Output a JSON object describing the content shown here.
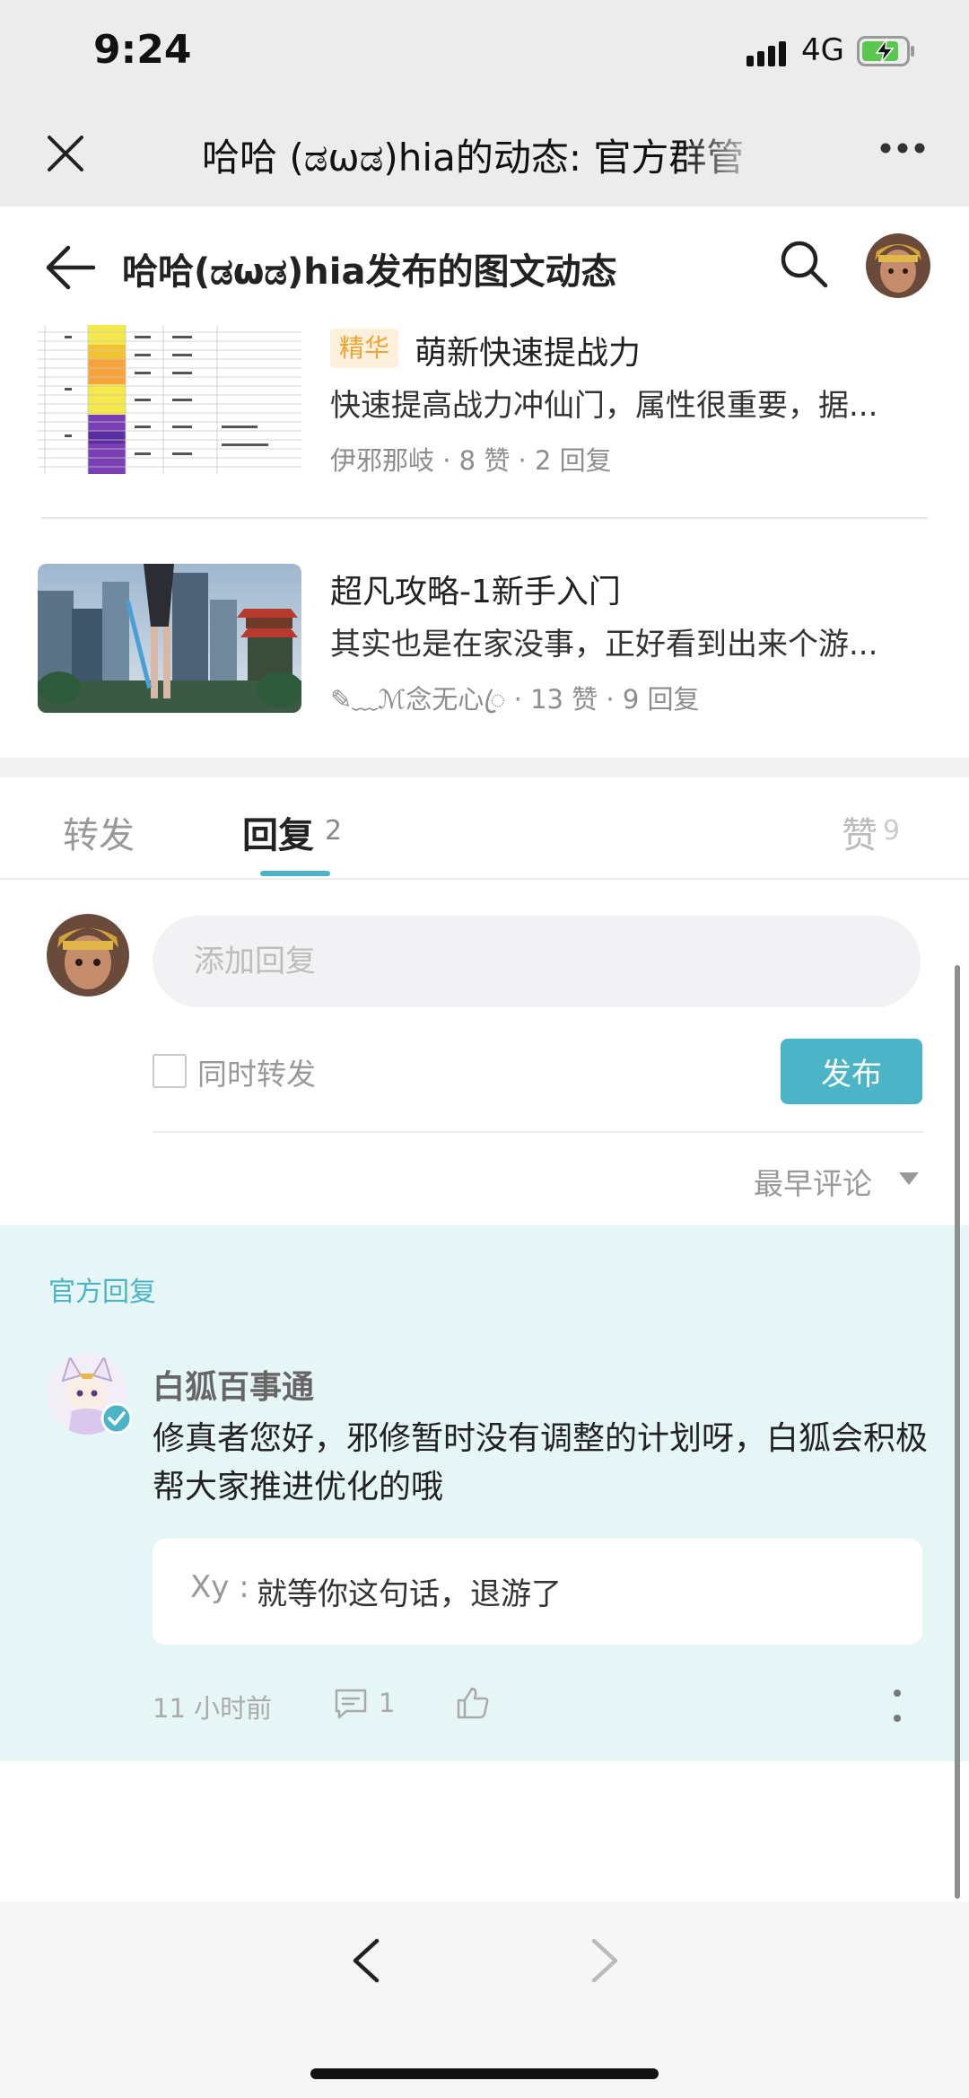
{
  "status_bar": {
    "time": "9:24",
    "network": "4G"
  },
  "wechat_bar": {
    "title": "哈哈 (ಡωಡ)hia的动态: 官方群管"
  },
  "header": {
    "title": "哈哈(ಡωಡ)hia发布的图文动态"
  },
  "articles": [
    {
      "badge": "精华",
      "title": "萌新快速提战力",
      "summary": "快速提高战力冲仙门，属性很重要，据...",
      "meta": "伊邪那岐 · 8 赞 · 2 回复"
    },
    {
      "title": "超凡攻略-1新手入门",
      "summary": "其实也是在家没事，正好看到出来个游...",
      "meta": "✎﹏ℳ念无心ꦿ · 13 赞 · 9 回复"
    }
  ],
  "tabs": {
    "forward": "转发",
    "reply": "回复",
    "reply_count": "2",
    "like": "赞",
    "like_count": "9"
  },
  "composer": {
    "placeholder": "添加回复",
    "also_forward": "同时转发",
    "publish": "发布",
    "sort": "最早评论"
  },
  "official_reply": {
    "label": "官方回复",
    "author": "白狐百事通",
    "text": "修真者您好，邪修暂时没有调整的计划呀，白狐会积极帮大家推进优化的哦",
    "quote_user": "Xy :",
    "quote_text": "就等你这句话，退游了",
    "time": "11 小时前",
    "comment_count": "1"
  },
  "colors": {
    "accent": "#4cb4c7",
    "official_bg": "#e6f5f6",
    "badge_text": "#f0a533",
    "badge_bg": "#fdf0dc"
  },
  "icons": [
    "close-icon",
    "more-icon",
    "back-arrow-icon",
    "search-icon",
    "checkbox-icon",
    "caret-down-icon",
    "verified-icon",
    "comment-icon",
    "thumbs-up-icon",
    "kebab-icon",
    "chevron-left-icon",
    "chevron-right-icon"
  ]
}
